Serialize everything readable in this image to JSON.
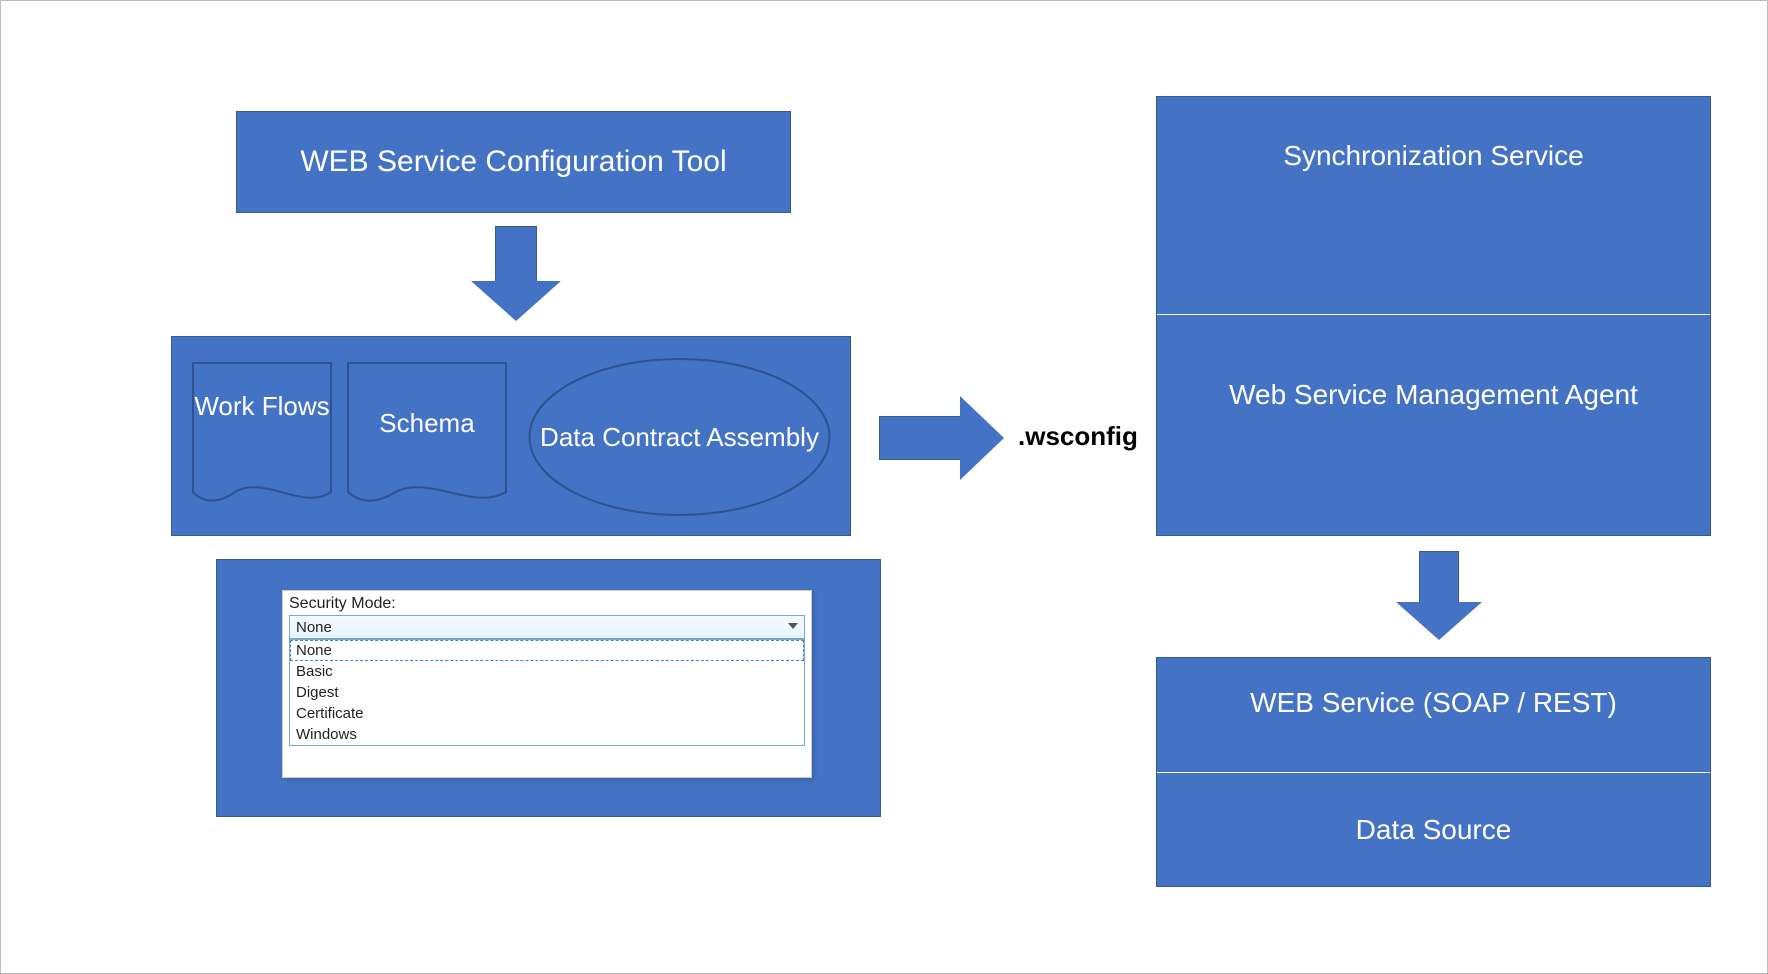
{
  "top": {
    "config_tool": "WEB Service Configuration Tool"
  },
  "components": {
    "workflows": "Work Flows",
    "schema": "Schema",
    "data_contract": "Data Contract Assembly"
  },
  "wsconfig_label": ".wsconfig",
  "right_stack": {
    "sync": "Synchronization Service",
    "agent": "Web Service Management Agent"
  },
  "bottom_stack": {
    "web_service": "WEB Service (SOAP / REST)",
    "data_source": "Data Source"
  },
  "security": {
    "label": "Security Mode:",
    "selected": "None",
    "options": [
      "None",
      "Basic",
      "Digest",
      "Certificate",
      "Windows"
    ]
  }
}
